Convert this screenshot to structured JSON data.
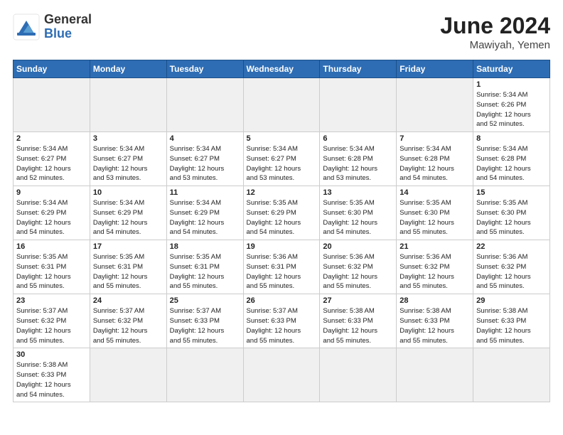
{
  "header": {
    "logo_general": "General",
    "logo_blue": "Blue",
    "month_year": "June 2024",
    "location": "Mawiyah, Yemen"
  },
  "weekdays": [
    "Sunday",
    "Monday",
    "Tuesday",
    "Wednesday",
    "Thursday",
    "Friday",
    "Saturday"
  ],
  "cells": [
    {
      "day": "",
      "content": ""
    },
    {
      "day": "",
      "content": ""
    },
    {
      "day": "",
      "content": ""
    },
    {
      "day": "",
      "content": ""
    },
    {
      "day": "",
      "content": ""
    },
    {
      "day": "",
      "content": ""
    },
    {
      "day": "1",
      "content": "Sunrise: 5:34 AM\nSunset: 6:26 PM\nDaylight: 12 hours\nand 52 minutes."
    },
    {
      "day": "2",
      "content": "Sunrise: 5:34 AM\nSunset: 6:27 PM\nDaylight: 12 hours\nand 52 minutes."
    },
    {
      "day": "3",
      "content": "Sunrise: 5:34 AM\nSunset: 6:27 PM\nDaylight: 12 hours\nand 53 minutes."
    },
    {
      "day": "4",
      "content": "Sunrise: 5:34 AM\nSunset: 6:27 PM\nDaylight: 12 hours\nand 53 minutes."
    },
    {
      "day": "5",
      "content": "Sunrise: 5:34 AM\nSunset: 6:27 PM\nDaylight: 12 hours\nand 53 minutes."
    },
    {
      "day": "6",
      "content": "Sunrise: 5:34 AM\nSunset: 6:28 PM\nDaylight: 12 hours\nand 53 minutes."
    },
    {
      "day": "7",
      "content": "Sunrise: 5:34 AM\nSunset: 6:28 PM\nDaylight: 12 hours\nand 54 minutes."
    },
    {
      "day": "8",
      "content": "Sunrise: 5:34 AM\nSunset: 6:28 PM\nDaylight: 12 hours\nand 54 minutes."
    },
    {
      "day": "9",
      "content": "Sunrise: 5:34 AM\nSunset: 6:29 PM\nDaylight: 12 hours\nand 54 minutes."
    },
    {
      "day": "10",
      "content": "Sunrise: 5:34 AM\nSunset: 6:29 PM\nDaylight: 12 hours\nand 54 minutes."
    },
    {
      "day": "11",
      "content": "Sunrise: 5:34 AM\nSunset: 6:29 PM\nDaylight: 12 hours\nand 54 minutes."
    },
    {
      "day": "12",
      "content": "Sunrise: 5:35 AM\nSunset: 6:29 PM\nDaylight: 12 hours\nand 54 minutes."
    },
    {
      "day": "13",
      "content": "Sunrise: 5:35 AM\nSunset: 6:30 PM\nDaylight: 12 hours\nand 54 minutes."
    },
    {
      "day": "14",
      "content": "Sunrise: 5:35 AM\nSunset: 6:30 PM\nDaylight: 12 hours\nand 55 minutes."
    },
    {
      "day": "15",
      "content": "Sunrise: 5:35 AM\nSunset: 6:30 PM\nDaylight: 12 hours\nand 55 minutes."
    },
    {
      "day": "16",
      "content": "Sunrise: 5:35 AM\nSunset: 6:31 PM\nDaylight: 12 hours\nand 55 minutes."
    },
    {
      "day": "17",
      "content": "Sunrise: 5:35 AM\nSunset: 6:31 PM\nDaylight: 12 hours\nand 55 minutes."
    },
    {
      "day": "18",
      "content": "Sunrise: 5:35 AM\nSunset: 6:31 PM\nDaylight: 12 hours\nand 55 minutes."
    },
    {
      "day": "19",
      "content": "Sunrise: 5:36 AM\nSunset: 6:31 PM\nDaylight: 12 hours\nand 55 minutes."
    },
    {
      "day": "20",
      "content": "Sunrise: 5:36 AM\nSunset: 6:32 PM\nDaylight: 12 hours\nand 55 minutes."
    },
    {
      "day": "21",
      "content": "Sunrise: 5:36 AM\nSunset: 6:32 PM\nDaylight: 12 hours\nand 55 minutes."
    },
    {
      "day": "22",
      "content": "Sunrise: 5:36 AM\nSunset: 6:32 PM\nDaylight: 12 hours\nand 55 minutes."
    },
    {
      "day": "23",
      "content": "Sunrise: 5:37 AM\nSunset: 6:32 PM\nDaylight: 12 hours\nand 55 minutes."
    },
    {
      "day": "24",
      "content": "Sunrise: 5:37 AM\nSunset: 6:32 PM\nDaylight: 12 hours\nand 55 minutes."
    },
    {
      "day": "25",
      "content": "Sunrise: 5:37 AM\nSunset: 6:33 PM\nDaylight: 12 hours\nand 55 minutes."
    },
    {
      "day": "26",
      "content": "Sunrise: 5:37 AM\nSunset: 6:33 PM\nDaylight: 12 hours\nand 55 minutes."
    },
    {
      "day": "27",
      "content": "Sunrise: 5:38 AM\nSunset: 6:33 PM\nDaylight: 12 hours\nand 55 minutes."
    },
    {
      "day": "28",
      "content": "Sunrise: 5:38 AM\nSunset: 6:33 PM\nDaylight: 12 hours\nand 55 minutes."
    },
    {
      "day": "29",
      "content": "Sunrise: 5:38 AM\nSunset: 6:33 PM\nDaylight: 12 hours\nand 55 minutes."
    },
    {
      "day": "30",
      "content": "Sunrise: 5:38 AM\nSunset: 6:33 PM\nDaylight: 12 hours\nand 54 minutes."
    },
    {
      "day": "",
      "content": ""
    },
    {
      "day": "",
      "content": ""
    },
    {
      "day": "",
      "content": ""
    },
    {
      "day": "",
      "content": ""
    },
    {
      "day": "",
      "content": ""
    },
    {
      "day": "",
      "content": ""
    }
  ]
}
